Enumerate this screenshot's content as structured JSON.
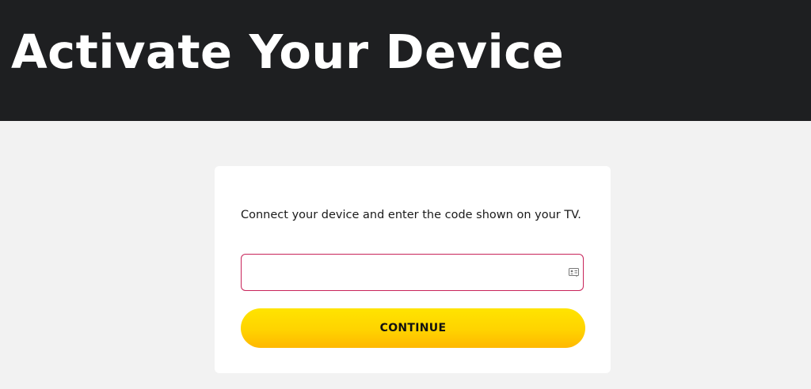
{
  "header": {
    "title": "Activate Your Device"
  },
  "activation": {
    "instruction": "Connect your device and enter the code shown on your TV.",
    "code_value": "",
    "autofill_icon": "contact-card-autofill-icon",
    "continue_label": "CONTINUE"
  },
  "colors": {
    "header_background": "#1e1f21",
    "page_background": "#f2f2f2",
    "input_border": "#c8245a",
    "button_gradient_top": "#ffe400",
    "button_gradient_bottom": "#ffb800"
  }
}
